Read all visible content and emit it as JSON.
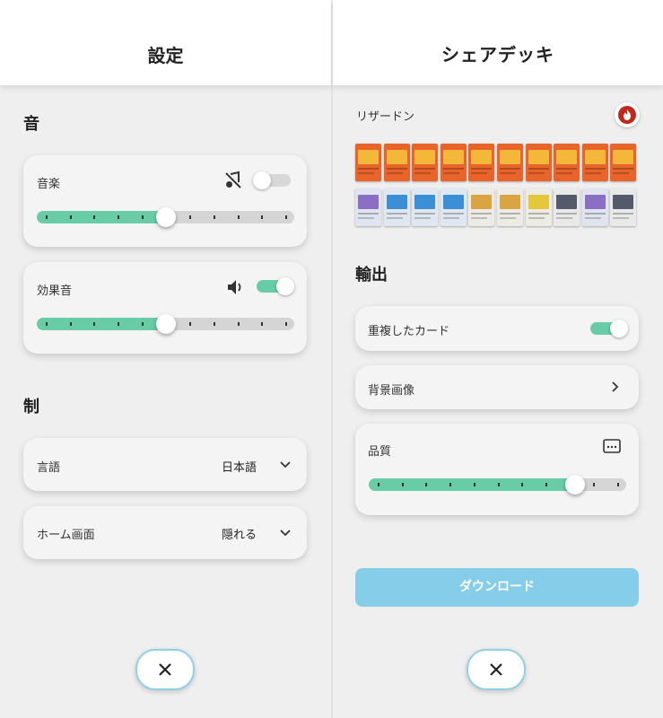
{
  "settings": {
    "title": "設定",
    "sound_section": "音",
    "music": {
      "label": "音楽",
      "enabled": false,
      "level": 0.5,
      "icon": "music-off-icon"
    },
    "effects": {
      "label": "効果音",
      "enabled": true,
      "level": 0.5,
      "icon": "volume-icon"
    },
    "control_section": "制",
    "language": {
      "label": "言語",
      "value": "日本語"
    },
    "home_screen": {
      "label": "ホーム画面",
      "value": "隠れる"
    }
  },
  "share": {
    "title": "シェアデッキ",
    "deck_name": "リザードン",
    "deck_type_icon": "fire-type-icon",
    "deck_cards": {
      "row1": [
        "fire",
        "fire",
        "fire",
        "fire",
        "fire",
        "fire",
        "fire",
        "fire",
        "fire",
        "fire"
      ],
      "row2": [
        "psychic",
        "water",
        "water",
        "water",
        "colorless",
        "colorless",
        "electric",
        "trainer",
        "psychic",
        "trainer"
      ]
    },
    "output_section": "輸出",
    "duplicates": {
      "label": "重複したカード",
      "enabled": true
    },
    "background": {
      "label": "背景画像"
    },
    "quality": {
      "label": "品質",
      "level": 0.8
    },
    "download_label": "ダウンロード"
  },
  "colors": {
    "accent": "#68cca6",
    "download": "#85cde9",
    "close_border": "#8fd0e8"
  }
}
